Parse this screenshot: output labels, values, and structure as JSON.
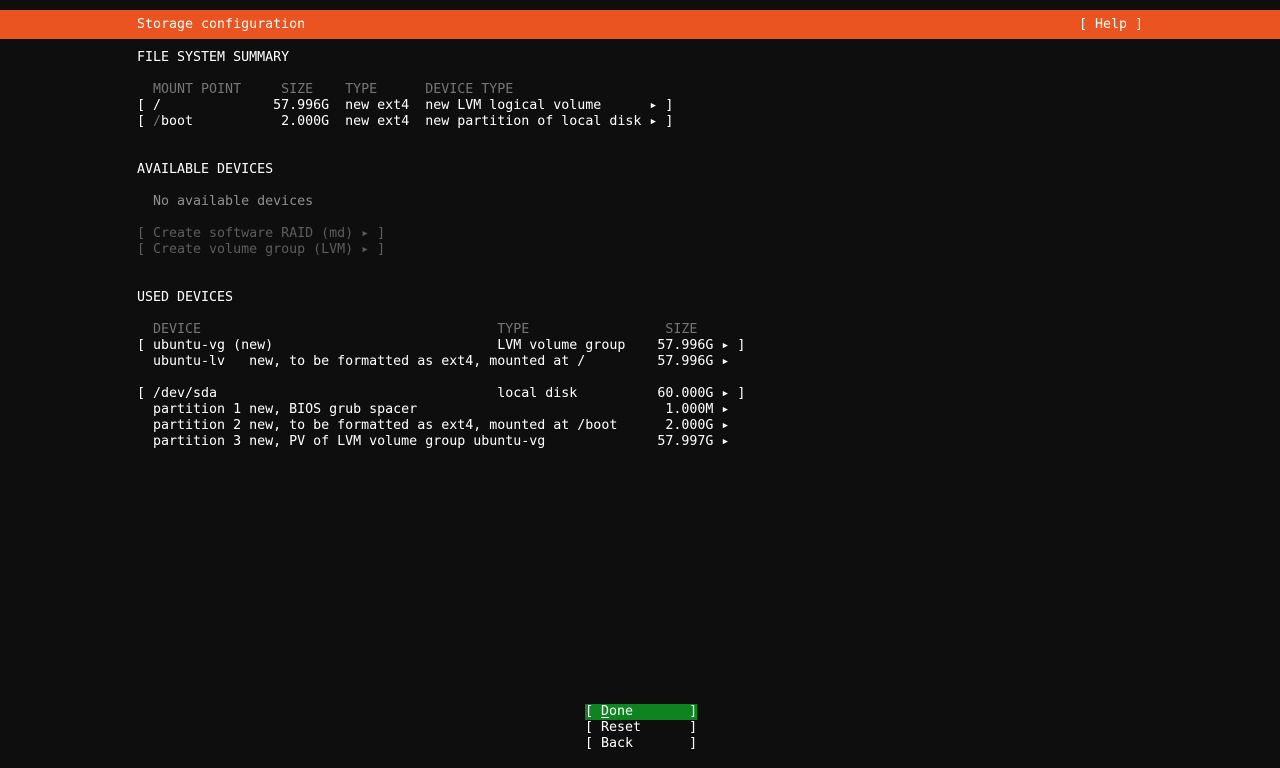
{
  "titlebar": {
    "title": "Storage configuration",
    "help_label": "[ Help ]"
  },
  "fs_summary": {
    "section_title": "FILE SYSTEM SUMMARY",
    "header_row": "  MOUNT POINT     SIZE    TYPE      DEVICE TYPE",
    "root_row": "[ /              57.996G  new ext4  new LVM logical volume      ▸ ]",
    "boot_row": {
      "open": "[ ",
      "dim_prefix": "/",
      "rest": "boot           2.000G  new ext4  new partition of local disk ▸ ]"
    }
  },
  "available_devices": {
    "section_title": "AVAILABLE DEVICES",
    "empty_note": "  No available devices",
    "create_raid_label": "[ Create software RAID (md) ▸ ]",
    "create_lvm_label": "[ Create volume group (LVM) ▸ ]"
  },
  "used_devices": {
    "section_title": "USED DEVICES",
    "header_row": "  DEVICE                                     TYPE                 SIZE",
    "vg_row": "[ ubuntu-vg (new)                            LVM volume group    57.996G ▸ ]",
    "lv_row": "  ubuntu-lv   new, to be formatted as ext4, mounted at /         57.996G ▸",
    "sda_row": "[ /dev/sda                                   local disk          60.000G ▸ ]",
    "p1_row": "  partition 1 new, BIOS grub spacer                               1.000M ▸",
    "p2_row": "  partition 2 new, to be formatted as ext4, mounted at /boot      2.000G ▸",
    "p3_row": "  partition 3 new, PV of LVM volume group ubuntu-vg              57.997G ▸"
  },
  "buttons": {
    "done": {
      "open": "[ ",
      "cursor": "D",
      "rest": "one       ]"
    },
    "reset_label": "[ Reset      ]",
    "back_label": "[ Back       ]"
  },
  "colors": {
    "titlebar_orange": "#E95420",
    "focus_green": "#0E8420",
    "text_white": "#ffffff",
    "text_gray": "#757575",
    "background": "#0e0e0e"
  }
}
